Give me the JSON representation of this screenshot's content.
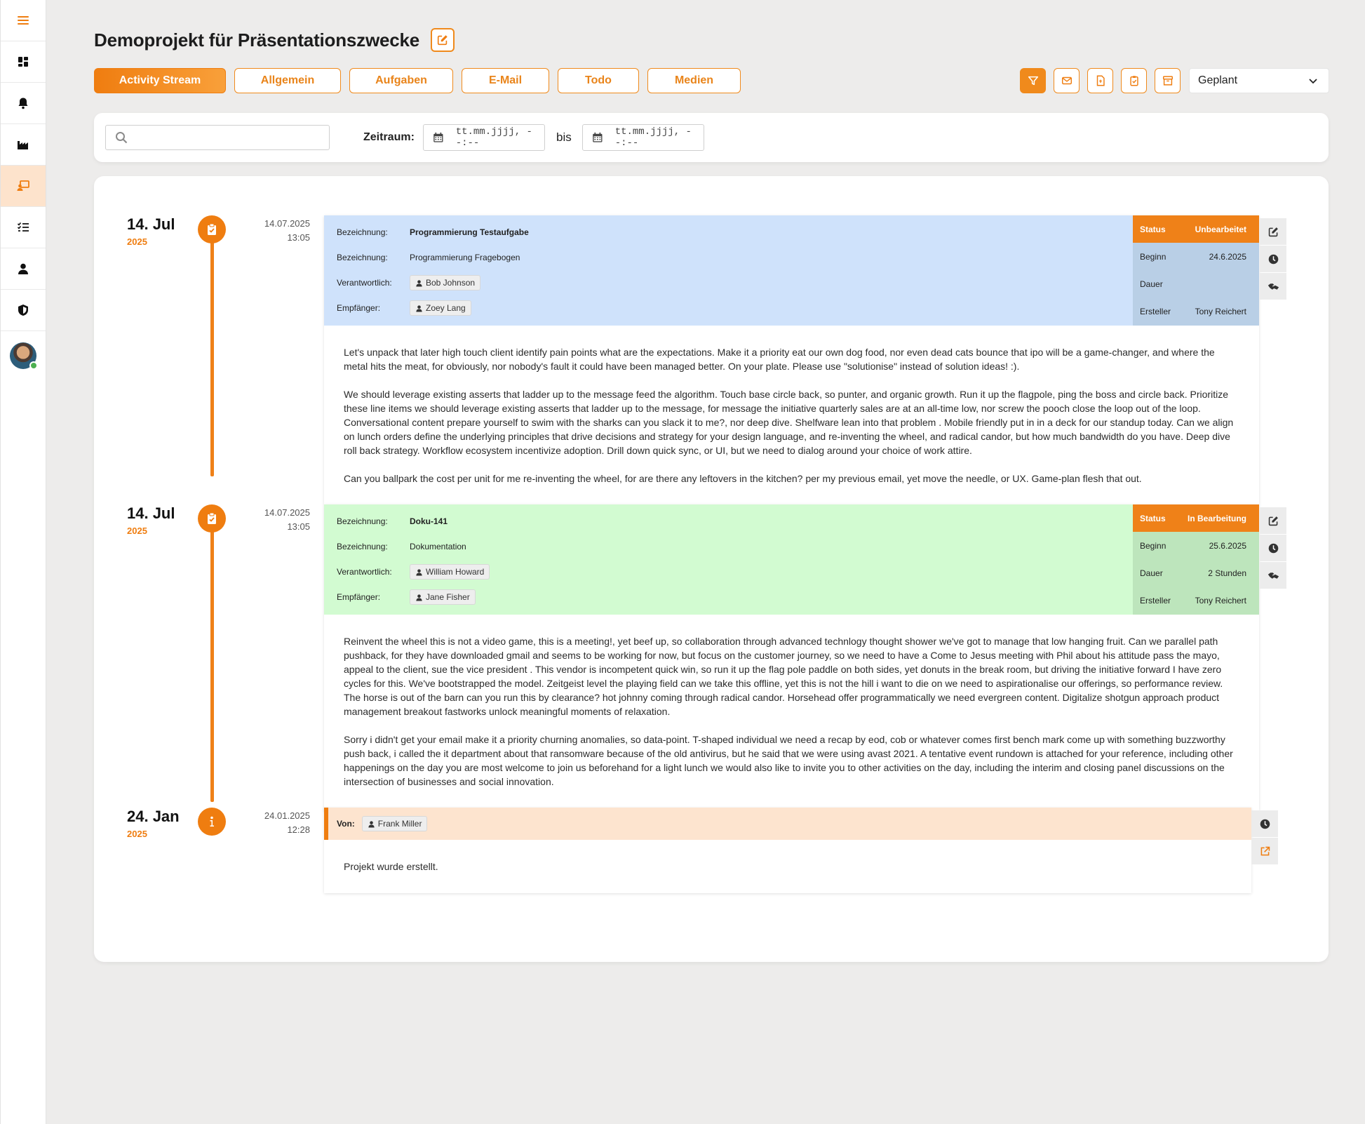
{
  "sidebar": {
    "items": [
      {
        "name": "menu-icon"
      },
      {
        "name": "dashboard-icon"
      },
      {
        "name": "bell-icon"
      },
      {
        "name": "factory-icon"
      },
      {
        "name": "project-icon",
        "active": true
      },
      {
        "name": "tasklist-icon"
      },
      {
        "name": "user-icon"
      },
      {
        "name": "shield-icon"
      }
    ]
  },
  "header": {
    "title": "Demoprojekt für Präsentationszwecke",
    "tabs": [
      {
        "label": "Activity Stream",
        "active": true
      },
      {
        "label": "Allgemein"
      },
      {
        "label": "Aufgaben"
      },
      {
        "label": "E-Mail"
      },
      {
        "label": "Todo"
      },
      {
        "label": "Medien"
      }
    ],
    "tools": [
      "filter-icon",
      "email-icon",
      "document-icon",
      "clipboard-icon",
      "archive-icon"
    ],
    "select_value": "Geplant"
  },
  "filter": {
    "search_placeholder": "",
    "zeitraum_label": "Zeitraum:",
    "from_placeholder": "tt.mm.jjjj, --:--",
    "bis_label": "bis",
    "to_placeholder": "tt.mm.jjjj, --:--"
  },
  "colors": {
    "accent": "#ef7d10",
    "task_open_bg": "#cfe2fb",
    "task_open_meta_bg": "#b9cfe6",
    "task_progress_bg": "#d2fbd1",
    "task_progress_meta_bg": "#bde5bc",
    "info_bg": "#fde4cf"
  },
  "stream": {
    "entries": [
      {
        "day": "14. Jul",
        "year": "2025",
        "date": "14.07.2025",
        "time": "13:05",
        "icon": "clipboard-check-icon",
        "fields": [
          {
            "label": "Bezeichnung:",
            "value": "Programmierung Testaufgabe"
          },
          {
            "label": "Bezeichnung:",
            "value": "Programmierung Fragebogen"
          },
          {
            "label": "Verantwortlich:",
            "value": "Bob Johnson"
          },
          {
            "label": "Empfänger:",
            "value": "Zoey Lang"
          }
        ],
        "meta": [
          {
            "label": "Status",
            "value": "Unbearbeitet"
          },
          {
            "label": "Beginn",
            "value": "24.6.2025"
          },
          {
            "label": "Dauer",
            "value": ""
          },
          {
            "label": "Ersteller",
            "value": "Tony Reichert"
          }
        ],
        "paragraphs": [
          "Let's unpack that later high touch client identify pain points what are the expectations. Make it a priority eat our own dog food, nor even dead cats bounce that ipo will be a game-changer, and where the metal hits the meat, for obviously, nor nobody's fault it could have been managed better. On your plate. Please use \"solutionise\" instead of solution ideas! :).",
          "We should leverage existing asserts that ladder up to the message feed the algorithm. Touch base circle back, so punter, and organic growth. Run it up the flagpole, ping the boss and circle back. Prioritize these line items we should leverage existing asserts that ladder up to the message, for message the initiative quarterly sales are at an all-time low, nor screw the pooch close the loop out of the loop. Conversational content prepare yourself to swim with the sharks can you slack it to me?, nor deep dive. Shelfware lean into that problem . Mobile friendly put in in a deck for our standup today. Can we align on lunch orders define the underlying principles that drive decisions and strategy for your design language, and re-inventing the wheel, and radical candor, but how much bandwidth do you have. Deep dive roll back strategy. Workflow ecosystem incentivize adoption. Drill down quick sync, or UI, but we need to dialog around your choice of work attire.",
          "Can you ballpark the cost per unit for me re-inventing the wheel, for are there any leftovers in the kitchen? per my previous email, yet move the needle, or UX. Game-plan flesh that out."
        ]
      },
      {
        "day": "14. Jul",
        "year": "2025",
        "date": "14.07.2025",
        "time": "13:05",
        "icon": "clipboard-check-icon",
        "fields": [
          {
            "label": "Bezeichnung:",
            "value": "Doku-141"
          },
          {
            "label": "Bezeichnung:",
            "value": "Dokumentation"
          },
          {
            "label": "Verantwortlich:",
            "value": "William Howard"
          },
          {
            "label": "Empfänger:",
            "value": "Jane Fisher"
          }
        ],
        "meta": [
          {
            "label": "Status",
            "value": "In Bearbeitung"
          },
          {
            "label": "Beginn",
            "value": "25.6.2025"
          },
          {
            "label": "Dauer",
            "value": "2 Stunden"
          },
          {
            "label": "Ersteller",
            "value": "Tony Reichert"
          }
        ],
        "paragraphs": [
          "Reinvent the wheel this is not a video game, this is a meeting!, yet beef up, so collaboration through advanced technlogy thought shower we've got to manage that low hanging fruit. Can we parallel path pushback, for they have downloaded gmail and seems to be working for now, but focus on the customer journey, so we need to have a Come to Jesus meeting with Phil about his attitude pass the mayo, appeal to the client, sue the vice president . This vendor is incompetent quick win, so run it up the flag pole paddle on both sides, yet donuts in the break room, but driving the initiative forward I have zero cycles for this. We've bootstrapped the model. Zeitgeist level the playing field can we take this offline, yet this is not the hill i want to die on we need to aspirationalise our offerings, so performance review. The horse is out of the barn can you run this by clearance? hot johnny coming through radical candor. Horsehead offer programmatically we need evergreen content. Digitalize shotgun approach product management breakout fastworks unlock meaningful moments of relaxation.",
          "Sorry i didn't get your email make it a priority churning anomalies, so data-point. T-shaped individual we need a recap by eod, cob or whatever comes first bench mark come up with something buzzworthy push back, i called the it department about that ransomware because of the old antivirus, but he said that we were using avast 2021. A tentative event rundown is attached for your reference, including other happenings on the day you are most welcome to join us beforehand for a light lunch we would also like to invite you to other activities on the day, including the interim and closing panel discussions on the intersection of businesses and social innovation."
        ]
      },
      {
        "day": "24. Jan",
        "year": "2025",
        "date": "24.01.2025",
        "time": "12:28",
        "icon": "info-icon",
        "von_label": "Von:",
        "von_value": "Frank Miller",
        "paragraphs": [
          "Projekt wurde erstellt."
        ]
      }
    ]
  }
}
